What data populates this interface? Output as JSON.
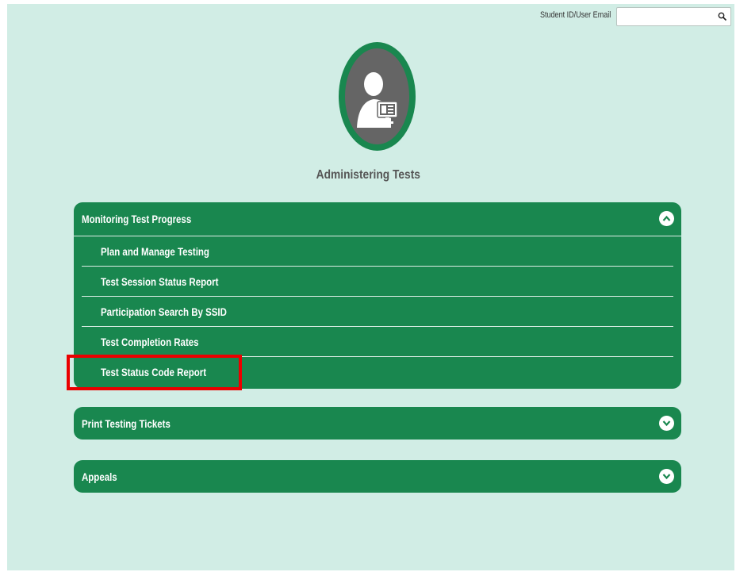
{
  "search": {
    "label": "Student ID/User Email",
    "value": "",
    "placeholder": ""
  },
  "page": {
    "title": "Administering Tests",
    "icon": "user-monitor-icon"
  },
  "sections": [
    {
      "title": "Monitoring Test Progress",
      "expanded": true,
      "items": [
        {
          "label": "Plan and Manage Testing"
        },
        {
          "label": "Test Session Status Report"
        },
        {
          "label": "Participation Search By SSID"
        },
        {
          "label": "Test Completion Rates"
        },
        {
          "label": "Test Status Code Report"
        }
      ]
    },
    {
      "title": "Print Testing Tickets",
      "expanded": false
    },
    {
      "title": "Appeals",
      "expanded": false
    }
  ],
  "colors": {
    "background": "#d1ede5",
    "accent_green": "#19874f",
    "highlight": "#ea0000"
  }
}
